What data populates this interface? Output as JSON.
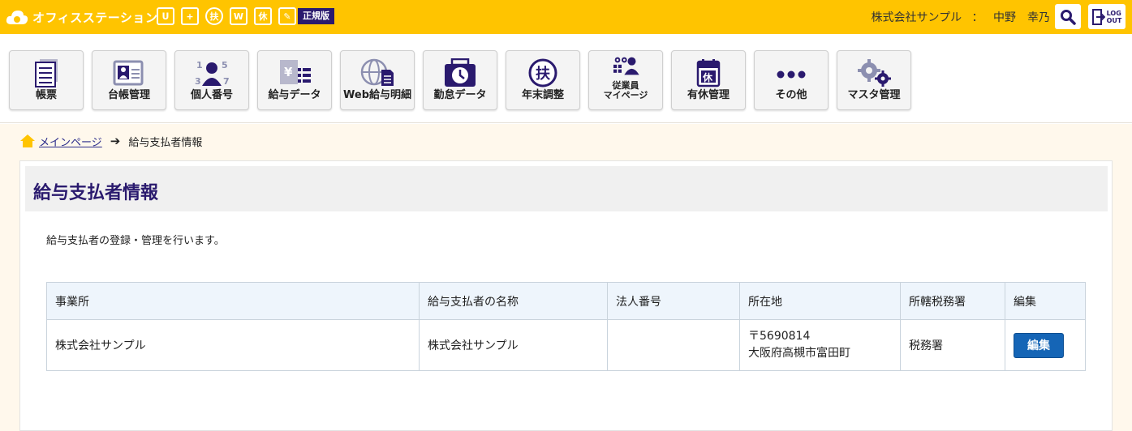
{
  "header": {
    "app_name": "オフィスステーション",
    "edition": "正規版",
    "company": "株式会社サンプル",
    "separator": "：",
    "user": "中野　幸乃",
    "logout_label_1": "LOG",
    "logout_label_2": "OUT",
    "app_icons": [
      {
        "icon": "rabbit-icon",
        "text": "ᑌ"
      },
      {
        "icon": "medical-bag-icon",
        "text": "+"
      },
      {
        "icon": "fuyou-icon",
        "text": "扶"
      },
      {
        "icon": "web-icon",
        "text": "W"
      },
      {
        "icon": "kyu-icon",
        "text": "休"
      },
      {
        "icon": "pen-icon",
        "text": "✎"
      }
    ]
  },
  "nav": {
    "items": [
      {
        "label": "帳票"
      },
      {
        "label": "台帳管理"
      },
      {
        "label": "個人番号"
      },
      {
        "label": "給与データ"
      },
      {
        "label": "Web給与明細"
      },
      {
        "label": "勤怠データ"
      },
      {
        "label": "年末調整"
      },
      {
        "label": "従業員\nマイページ"
      },
      {
        "label": "有休管理"
      },
      {
        "label": "その他"
      },
      {
        "label": "マスタ管理"
      }
    ]
  },
  "breadcrumb": {
    "home": "メインページ",
    "current": "給与支払者情報"
  },
  "page": {
    "title": "給与支払者情報",
    "description": "給与支払者の登録・管理を行います。"
  },
  "table": {
    "headers": [
      "事業所",
      "給与支払者の名称",
      "法人番号",
      "所在地",
      "所轄税務署",
      "編集"
    ],
    "rows": [
      {
        "office": "株式会社サンプル",
        "payer_name": "株式会社サンプル",
        "corp_number": "",
        "postal": "〒5690814",
        "address": "大阪府高槻市富田町",
        "tax_office": "税務署",
        "edit_label": "編集"
      }
    ]
  },
  "colors": {
    "topbar": "#ffc400",
    "accent": "#2a1a6e",
    "button": "#1565b6"
  }
}
